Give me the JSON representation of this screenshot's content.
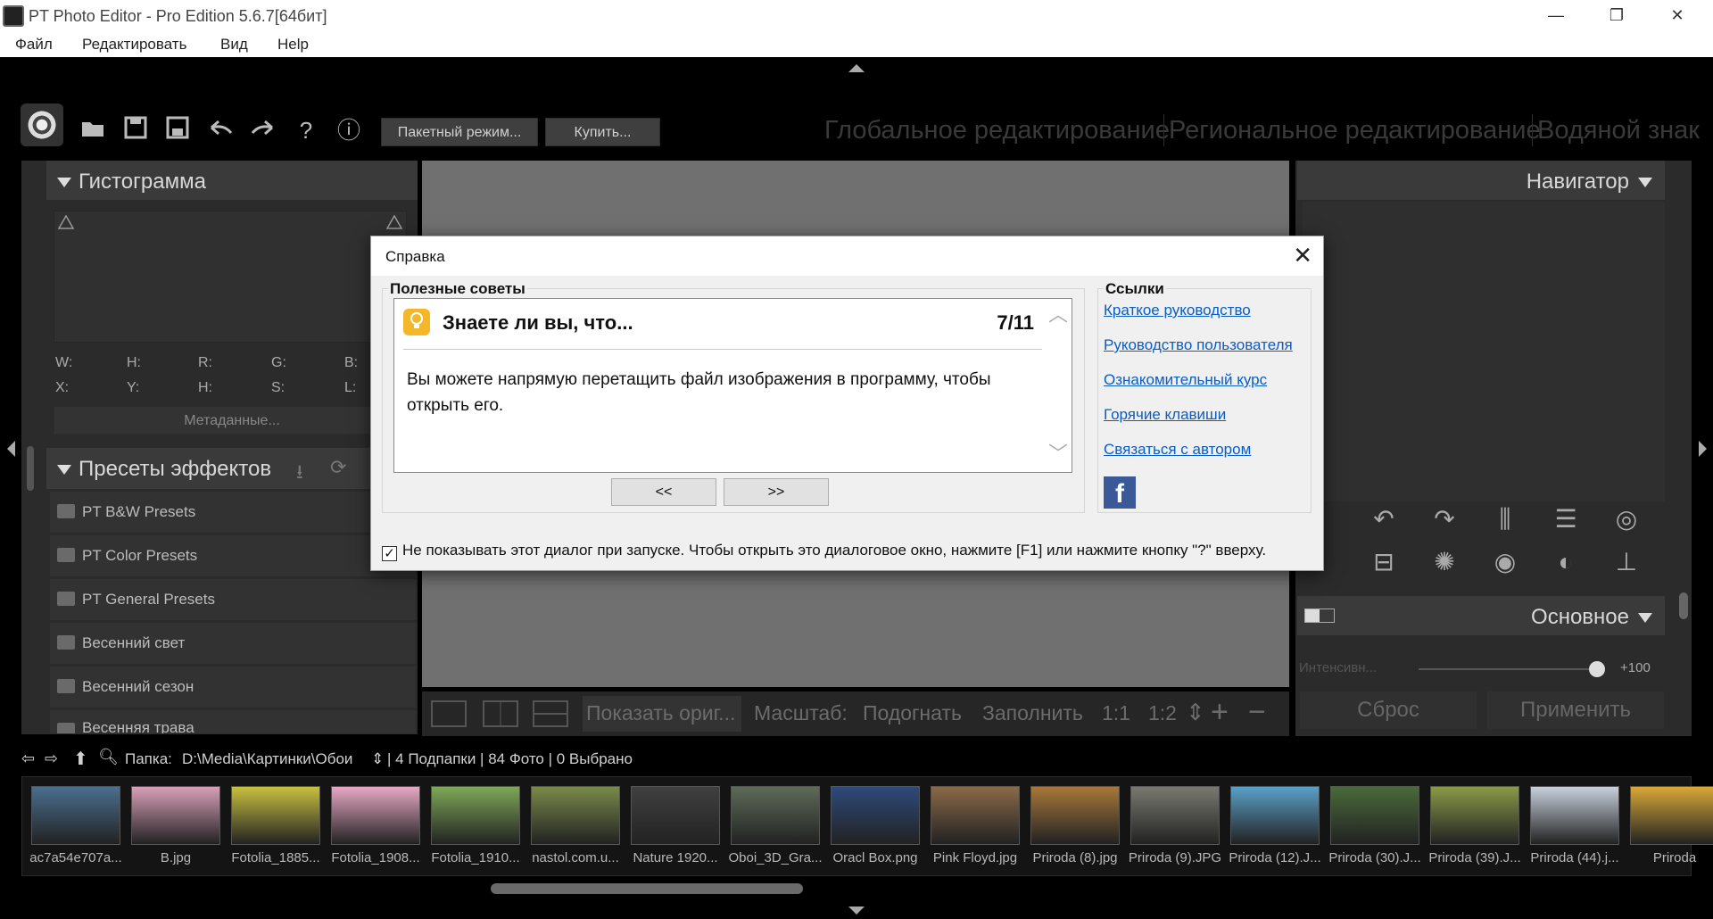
{
  "window": {
    "title": "PT Photo Editor - Pro Edition 5.6.7[64бит]",
    "minimize": "—",
    "maximize": "❐",
    "close": "✕"
  },
  "menu": [
    "Файл",
    "Редактировать",
    "Вид",
    "Help"
  ],
  "toolbar": {
    "batch_label": "Пакетный режим...",
    "buy_label": "Купить...",
    "help_glyph": "?",
    "info_glyph": "ⓘ"
  },
  "modes": [
    "Глобальное редактирование",
    "Региональное редактирование",
    "Водяной знак"
  ],
  "histogram": {
    "title": "Гистограмма",
    "row1": [
      "W:",
      "H:",
      "R:",
      "G:",
      "B:"
    ],
    "row2": [
      "X:",
      "Y:",
      "H:",
      "S:",
      "L:"
    ],
    "metadata_label": "Метаданные..."
  },
  "presets": {
    "title": "Пресеты эффектов",
    "items": [
      "PT B&W Presets",
      "PT Color Presets",
      "PT General Presets",
      "Весенний свет",
      "Весенний сезон",
      "Весенняя трава"
    ]
  },
  "canvas_bar": {
    "show_original": "Показать ориг...",
    "zoom_label": "Масштаб:",
    "fit": "Подогнать",
    "fill": "Заполнить",
    "one_to_one": "1:1",
    "one_to_two": "1:2"
  },
  "navigator": {
    "title": "Навигатор"
  },
  "basic": {
    "title": "Основное",
    "intensity_label": "Интенсивн...",
    "intensity_value": "+100",
    "intensity_level": 1.0,
    "reset_label": "Сброс",
    "apply_label": "Применить"
  },
  "path_bar": {
    "folder_label": "Папка:",
    "folder_path": "D:\\Media\\Картинки\\Обои",
    "summary": "| 4 Подпапки | 84 Фото | 0 Выбрано"
  },
  "thumbnails": [
    {
      "label": "ac7a54e707a...",
      "color": "#4a6f8f"
    },
    {
      "label": "B.jpg",
      "color": "#d8a0b8"
    },
    {
      "label": "Fotolia_1885...",
      "color": "#c8c040"
    },
    {
      "label": "Fotolia_1908...",
      "color": "#e7a8c4"
    },
    {
      "label": "Fotolia_1910...",
      "color": "#7ea858"
    },
    {
      "label": "nastol.com.u...",
      "color": "#7a8a4a"
    },
    {
      "label": "Nature 1920...",
      "color": "#404040"
    },
    {
      "label": "Oboi_3D_Gra...",
      "color": "#5e6a58"
    },
    {
      "label": "Oracl Box.png",
      "color": "#2e4a7a"
    },
    {
      "label": "Pink Floyd.jpg",
      "color": "#8a6a48"
    },
    {
      "label": "Priroda (8).jpg",
      "color": "#a8783a"
    },
    {
      "label": "Priroda (9).JPG",
      "color": "#7a7a72"
    },
    {
      "label": "Priroda (12).J...",
      "color": "#5aa0c8"
    },
    {
      "label": "Priroda (30).J...",
      "color": "#4a6a3a"
    },
    {
      "label": "Priroda (39).J...",
      "color": "#8a9a48"
    },
    {
      "label": "Priroda (44).j...",
      "color": "#c8d0dc"
    },
    {
      "label": "Priroda",
      "color": "#d8a838"
    }
  ],
  "dialog": {
    "title": "Справка",
    "close": "✕",
    "tips_group_title": "Полезные советы",
    "tip_heading": "Знаете ли вы, что...",
    "tip_counter": "7/11",
    "tip_text": "Вы можете напрямую перетащить файл изображения в программу, чтобы открыть его.",
    "prev_label": "<<",
    "next_label": ">>",
    "links_group_title": "Ссылки",
    "links": [
      "Краткое руководство",
      "Руководство пользователя",
      "Ознакомительный курс",
      "Горячие клавиши",
      "Связаться с автором"
    ],
    "dont_show_text": "Не показывать этот диалог при запуске. Чтобы открыть это диалоговое окно, нажмите [F1] или нажмите кнопку \"?\" вверху.",
    "dont_show_checked": true
  },
  "colors": {
    "link": "#0a5cc7",
    "facebook": "#3b5998",
    "bulb": "#f5b72a",
    "canvas": "#707070"
  }
}
